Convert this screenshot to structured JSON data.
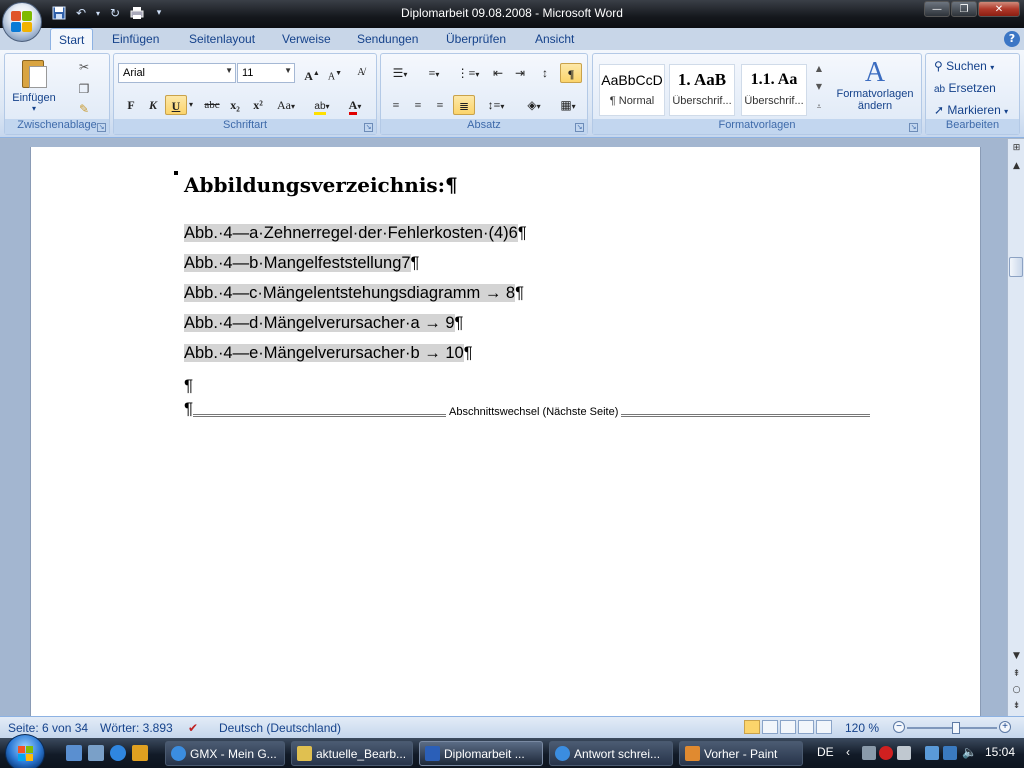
{
  "window": {
    "title": "Diplomarbeit 09.08.2008  -  Microsoft Word",
    "minimize_icon": "minimize-icon",
    "maximize_icon": "restore-icon",
    "close_icon": "close-icon"
  },
  "qat": {
    "save_icon": "save-icon",
    "undo_icon": "undo-icon",
    "redo_icon": "redo-icon",
    "print_icon": "print-icon",
    "customize_icon": "chevron-down-icon"
  },
  "ribbon": {
    "tabs": [
      {
        "label": "Start",
        "active": true
      },
      {
        "label": "Einfügen"
      },
      {
        "label": "Seitenlayout"
      },
      {
        "label": "Verweise"
      },
      {
        "label": "Sendungen"
      },
      {
        "label": "Überprüfen"
      },
      {
        "label": "Ansicht"
      }
    ],
    "groups": {
      "clipboard": {
        "label": "Zwischenablage",
        "paste_label": "Einfügen"
      },
      "font": {
        "label": "Schriftart",
        "font_name": "Arial",
        "font_size": "11",
        "bold": "F",
        "italic": "K",
        "underline": "U",
        "strike": "abc",
        "subscript": "x₂",
        "superscript": "x²",
        "case": "Aa",
        "grow": "A",
        "shrink": "A"
      },
      "paragraph": {
        "label": "Absatz"
      },
      "styles": {
        "label": "Formatvorlagen",
        "items": [
          {
            "sample": "AaBbCcD",
            "name": "¶ Normal"
          },
          {
            "sample": "1. AaB",
            "name": "Überschrif..."
          },
          {
            "sample": "1.1. Aa",
            "name": "Überschrif..."
          }
        ],
        "change_label": "Formatvorlagen ändern"
      },
      "editing": {
        "label": "Bearbeiten",
        "find": "Suchen",
        "replace": "Ersetzen",
        "select": "Markieren"
      }
    }
  },
  "document": {
    "heading": "Abbildungsverzeichnis:¶",
    "entries": [
      {
        "text": "Abb.·4—a·Zehnerregel·der·Fehlerkosten·(4)6",
        "mark": "¶"
      },
      {
        "text": "Abb.·4—b·Mangelfeststellung7",
        "mark": "¶"
      },
      {
        "text": "Abb.·4—c·Mängelentstehungsdiagramm → 8",
        "mark": "¶"
      },
      {
        "text": "Abb.·4—d·Mängelverursacher·a  →  9",
        "mark": "¶"
      },
      {
        "text": "Abb.·4—e·Mängelverursacher·b  →  10",
        "mark": "¶"
      }
    ],
    "empty_para": "¶",
    "section_break_para": "¶",
    "section_break_label": "Abschnittswechsel (Nächste Seite)"
  },
  "statusbar": {
    "page": "Seite: 6 von 34",
    "words": "Wörter: 3.893",
    "language": "Deutsch (Deutschland)",
    "zoom": "120 %",
    "zoom_fraction": 0.55
  },
  "taskbar": {
    "items": [
      {
        "label": "GMX - Mein G...",
        "icon": "ie-icon",
        "color": "#3b8de0"
      },
      {
        "label": "aktuelle_Bearb...",
        "icon": "folder-icon",
        "color": "#e0c050"
      },
      {
        "label": "Diplomarbeit ...",
        "icon": "word-icon",
        "color": "#2b5fb8",
        "active": true
      },
      {
        "label": "Antwort schrei...",
        "icon": "ie-icon",
        "color": "#3b8de0"
      },
      {
        "label": "Vorher - Paint",
        "icon": "paint-icon",
        "color": "#e08a30"
      }
    ],
    "lang": "DE",
    "time": "15:04"
  }
}
